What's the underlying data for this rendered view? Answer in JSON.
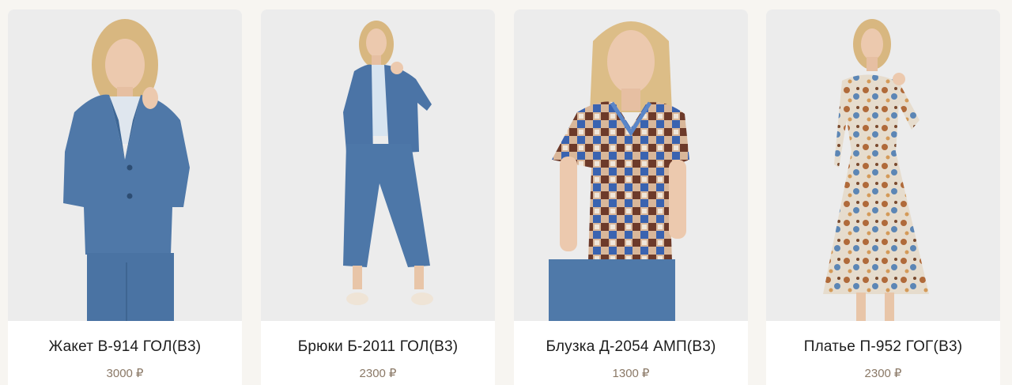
{
  "products": [
    {
      "title": "Жакет В-914 ГОЛ(В3)",
      "price": "3000",
      "currency": "₽",
      "colors": {
        "garment": "#4f78a8",
        "pants": "#4a73a3",
        "shirt": "#dfe6ee"
      }
    },
    {
      "title": "Брюки Б-2011 ГОЛ(В3)",
      "price": "2300",
      "currency": "₽",
      "colors": {
        "garment": "#4b74a6",
        "pants": "#4d77a8",
        "shirt": "#d7e4f0"
      }
    },
    {
      "title": "Блузка Д-2054 АМП(В3)",
      "price": "1300",
      "currency": "₽",
      "colors": {
        "garment": "#c9a58c",
        "pants": "#4f79a9",
        "accent": "#3a63b0"
      }
    },
    {
      "title": "Платье П-952 ГОГ(В3)",
      "price": "2300",
      "currency": "₽",
      "colors": {
        "garment": "#e6dccd",
        "accent": "#b06a3a",
        "accent2": "#5c86b5"
      }
    }
  ]
}
